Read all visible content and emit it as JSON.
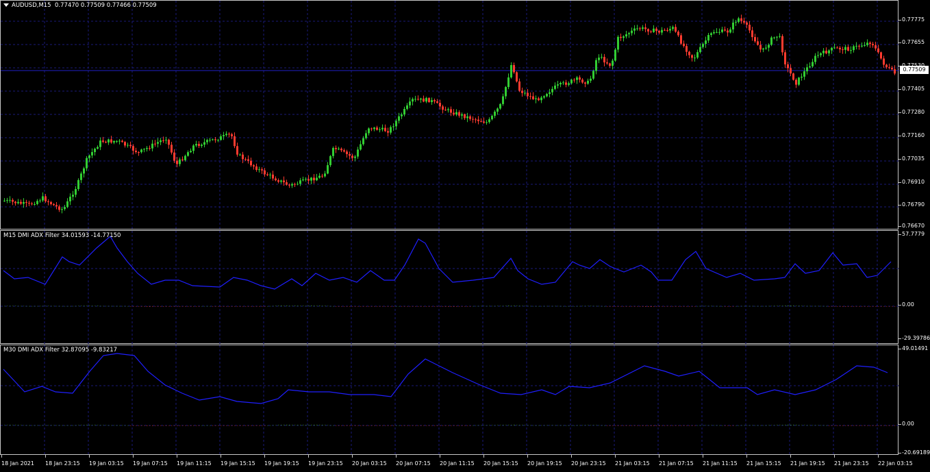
{
  "main": {
    "symbol": "AUDUSD,M15",
    "ohlc": "0.77470 0.77509 0.77466 0.77509",
    "price_ticks": [
      "0.77775",
      "0.77655",
      "0.77530",
      "0.77405",
      "0.77280",
      "0.77160",
      "0.77035",
      "0.76910",
      "0.76790",
      "0.76670"
    ],
    "current_price": "0.77509"
  },
  "ind1": {
    "title": "M15 DMI ADX Filter 34.01593 -14.77150",
    "ticks": [
      "57.7779",
      "0.00",
      "-29.39786"
    ]
  },
  "ind2": {
    "title": "M30 DMI ADX Filter 32.87095 -9.83217",
    "ticks": [
      "49.01491",
      "0.00",
      "-20.69189"
    ]
  },
  "time_labels": [
    "18 Jan 2021",
    "18 Jan 23:15",
    "19 Jan 03:15",
    "19 Jan 07:15",
    "19 Jan 11:15",
    "19 Jan 15:15",
    "19 Jan 19:15",
    "19 Jan 23:15",
    "20 Jan 03:15",
    "20 Jan 07:15",
    "20 Jan 11:15",
    "20 Jan 15:15",
    "20 Jan 19:15",
    "20 Jan 23:15",
    "21 Jan 03:15",
    "21 Jan 07:15",
    "21 Jan 11:15",
    "21 Jan 15:15",
    "21 Jan 19:15",
    "21 Jan 23:15",
    "22 Jan 03:15"
  ],
  "colors": {
    "bull": "#32cd32",
    "bear": "#ff3b2f",
    "adx": "#1f1fff",
    "hist_pos": "#3c8c2a",
    "hist_neg": "#c83222",
    "grid": "#1a1a7a"
  }
}
